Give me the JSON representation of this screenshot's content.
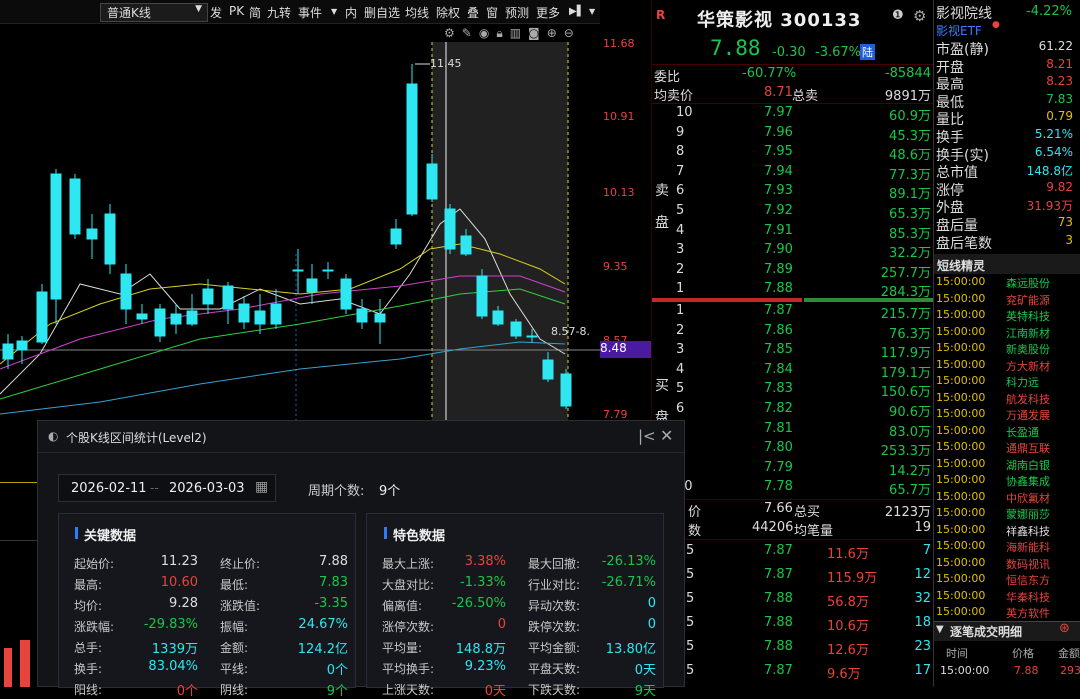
{
  "toolbar": {
    "kline_type": "普通K线",
    "items": [
      "发",
      "PK",
      "简",
      "九转",
      "事件",
      "内",
      "删自选",
      "均线",
      "除权",
      "叠",
      "窗",
      "预测",
      "更多"
    ]
  },
  "chart": {
    "price_labels": [
      "11.68",
      "10.91",
      "10.13",
      "9.35",
      "8.57",
      "7.79"
    ],
    "current_price_tag": "8.48",
    "high_label": "11.45",
    "range_label": "8.57-8.",
    "up_color": "#e8433d",
    "down_color": "#2ee7f0"
  },
  "stock": {
    "flag": "R",
    "name": "华策影视",
    "code": "300133",
    "price": "7.88",
    "change": "-0.30",
    "change_pct": "-3.67%",
    "board": "陆"
  },
  "wei": {
    "label": "委比",
    "pct": "-60.77%",
    "diff": "-85844",
    "avg_label": "均卖价",
    "avg_price": "8.71",
    "total_label": "总卖",
    "total": "9891万"
  },
  "asks": [
    {
      "n": "10",
      "p": "7.97",
      "v": "60.9万"
    },
    {
      "n": "9",
      "p": "7.96",
      "v": "45.3万"
    },
    {
      "n": "8",
      "p": "7.95",
      "v": "48.6万"
    },
    {
      "n": "7",
      "p": "7.94",
      "v": "77.3万"
    },
    {
      "n": "6",
      "p": "7.93",
      "v": "89.1万"
    },
    {
      "n": "5",
      "p": "7.92",
      "v": "65.3万"
    },
    {
      "n": "4",
      "p": "7.91",
      "v": "85.3万"
    },
    {
      "n": "3",
      "p": "7.90",
      "v": "32.2万"
    },
    {
      "n": "2",
      "p": "7.89",
      "v": "257.7万"
    },
    {
      "n": "1",
      "p": "7.88",
      "v": "284.3万"
    }
  ],
  "ask_side_label": "卖盘",
  "bids": [
    {
      "n": "1",
      "p": "7.87",
      "v": "215.7万"
    },
    {
      "n": "2",
      "p": "7.86",
      "v": "76.3万"
    },
    {
      "n": "3",
      "p": "7.85",
      "v": "117.9万"
    },
    {
      "n": "4",
      "p": "7.84",
      "v": "179.1万"
    },
    {
      "n": "5",
      "p": "7.83",
      "v": "150.6万"
    },
    {
      "n": "6",
      "p": "7.82",
      "v": "90.6万"
    },
    {
      "n": "7",
      "p": "7.81",
      "v": "83.0万"
    },
    {
      "n": "8",
      "p": "7.80",
      "v": "253.3万"
    },
    {
      "n": "9",
      "p": "7.79",
      "v": "14.2万"
    },
    {
      "n": "10",
      "p": "7.78",
      "v": "65.7万"
    }
  ],
  "bid_side_label": "买盘",
  "buy_summary": {
    "avg_label": "价",
    "avg": "7.66",
    "total_label": "总买",
    "total": "2123万",
    "cnt_label": "数",
    "cnt": "44206",
    "avg_cnt_label": "均笔量",
    "avg_cnt": "19"
  },
  "ticks": [
    {
      "a": "5",
      "p": "7.87",
      "v": "11.6万",
      "x": "7"
    },
    {
      "a": "5",
      "p": "7.87",
      "v": "115.9万",
      "x": "12"
    },
    {
      "a": "5",
      "p": "7.88",
      "v": "56.8万",
      "x": "32"
    },
    {
      "a": "5",
      "p": "7.88",
      "v": "10.6万",
      "x": "18"
    },
    {
      "a": "5",
      "p": "7.88",
      "v": "12.6万",
      "x": "23"
    },
    {
      "a": "5",
      "p": "7.87",
      "v": "9.6万",
      "x": "17"
    }
  ],
  "sector": {
    "name": "影视院线",
    "pct": "-4.22%",
    "etf": "影视ETF"
  },
  "stats": [
    {
      "l": "市盈(静)",
      "v": "61.22",
      "c": "w"
    },
    {
      "l": "开盘",
      "v": "8.21",
      "c": "r"
    },
    {
      "l": "最高",
      "v": "8.23",
      "c": "r"
    },
    {
      "l": "最低",
      "v": "7.83",
      "c": "g"
    },
    {
      "l": "量比",
      "v": "0.79",
      "c": "y"
    },
    {
      "l": "换手",
      "v": "5.21%",
      "c": "cy"
    },
    {
      "l": "换手(实)",
      "v": "6.54%",
      "c": "cy"
    },
    {
      "l": "总市值",
      "v": "148.8亿",
      "c": "cy"
    },
    {
      "l": "涨停",
      "v": "9.82",
      "c": "r"
    },
    {
      "l": "外盘",
      "v": "31.93万",
      "c": "r"
    },
    {
      "l": "盘后量",
      "v": "73",
      "c": "y"
    },
    {
      "l": "盘后笔数",
      "v": "3",
      "c": "y"
    }
  ],
  "sprite": {
    "title": "短线精灵",
    "rows": [
      {
        "t": "15:00:00",
        "n": "森远股份",
        "c": "g"
      },
      {
        "t": "15:00:00",
        "n": "兖矿能源",
        "c": "r"
      },
      {
        "t": "15:00:00",
        "n": "英特科技",
        "c": "g"
      },
      {
        "t": "15:00:00",
        "n": "江南新材",
        "c": "g"
      },
      {
        "t": "15:00:00",
        "n": "新奥股份",
        "c": "g"
      },
      {
        "t": "15:00:00",
        "n": "方大新材",
        "c": "r"
      },
      {
        "t": "15:00:00",
        "n": "科力远",
        "c": "g"
      },
      {
        "t": "15:00:00",
        "n": "航发科技",
        "c": "r"
      },
      {
        "t": "15:00:00",
        "n": "万通发展",
        "c": "r"
      },
      {
        "t": "15:00:00",
        "n": "长盈通",
        "c": "g"
      },
      {
        "t": "15:00:00",
        "n": "通鼎互联",
        "c": "r"
      },
      {
        "t": "15:00:00",
        "n": "湖南白银",
        "c": "g"
      },
      {
        "t": "15:00:00",
        "n": "协鑫集成",
        "c": "g"
      },
      {
        "t": "15:00:00",
        "n": "中欣氟材",
        "c": "r"
      },
      {
        "t": "15:00:00",
        "n": "蒙娜丽莎",
        "c": "g"
      },
      {
        "t": "15:00:00",
        "n": "祥鑫科技",
        "c": "w"
      },
      {
        "t": "15:00:00",
        "n": "海新能科",
        "c": "r"
      },
      {
        "t": "15:00:00",
        "n": "数码视讯",
        "c": "r"
      },
      {
        "t": "15:00:00",
        "n": "恒信东方",
        "c": "r"
      },
      {
        "t": "15:00:00",
        "n": "华秦科技",
        "c": "r"
      },
      {
        "t": "15:00:00",
        "n": "英方软件",
        "c": "r"
      }
    ]
  },
  "deals": {
    "title": "逐笔成交明细",
    "cols": [
      "时间",
      "价格",
      "金额"
    ],
    "row": {
      "t": "15:00:00",
      "p": "7.88",
      "v": "293"
    }
  },
  "popup": {
    "title": "个股K线区间统计(Level2)",
    "date_from": "2026-02-11",
    "sep": "--",
    "date_to": "2026-03-03",
    "period_label": "周期个数:",
    "period": "9个",
    "key_title": "关键数据",
    "feat_title": "特色数据",
    "key": [
      [
        "起始价:",
        "11.23",
        "w",
        "终止价:",
        "7.88",
        "w"
      ],
      [
        "最高:",
        "10.60",
        "r",
        "最低:",
        "7.83",
        "g"
      ],
      [
        "均价:",
        "9.28",
        "w",
        "涨跌值:",
        "-3.35",
        "g"
      ],
      [
        "涨跌幅:",
        "-29.83%",
        "g",
        "振幅:",
        "24.67%",
        "cy"
      ],
      [
        "总手:",
        "1339万",
        "cy",
        "金额:",
        "124.2亿",
        "cy"
      ],
      [
        "换手:",
        "83.04%",
        "cy",
        "平线:",
        "0个",
        "cy"
      ],
      [
        "阳线:",
        "0个",
        "r",
        "阴线:",
        "9个",
        "g"
      ]
    ],
    "feat": [
      [
        "最大上涨:",
        "3.38%",
        "r",
        "最大回撤:",
        "-26.13%",
        "g"
      ],
      [
        "大盘对比:",
        "-1.33%",
        "g",
        "行业对比:",
        "-26.71%",
        "g"
      ],
      [
        "偏离值:",
        "-26.50%",
        "g",
        "异动次数:",
        "0",
        "cy"
      ],
      [
        "涨停次数:",
        "0",
        "r",
        "跌停次数:",
        "0",
        "cy"
      ],
      [
        "平均量:",
        "148.8万",
        "cy",
        "平均金额:",
        "13.80亿",
        "cy"
      ],
      [
        "平均换手:",
        "9.23%",
        "cy",
        "平盘天数:",
        "0天",
        "cy"
      ],
      [
        "上涨天数:",
        "0天",
        "r",
        "下跌天数:",
        "9天",
        "g"
      ]
    ]
  }
}
